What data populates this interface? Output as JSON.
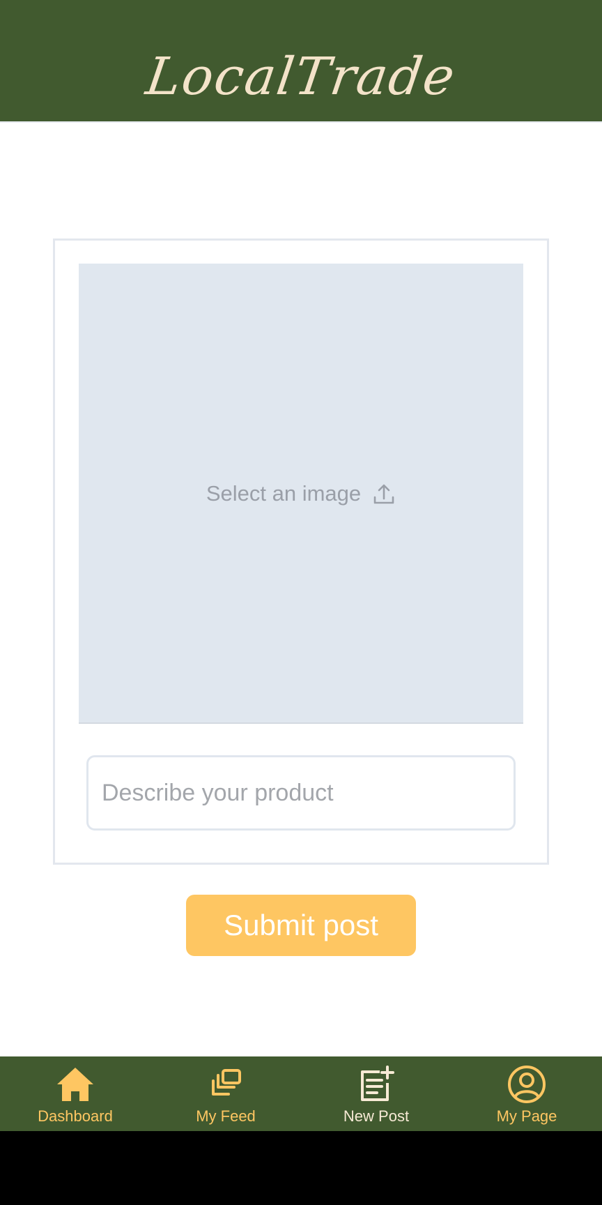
{
  "app": {
    "logo": "LocalTrade"
  },
  "form": {
    "image_prompt": "Select an image",
    "description_placeholder": "Describe your product",
    "description_value": "",
    "submit_label": "Submit post"
  },
  "nav": {
    "items": [
      {
        "label": "Dashboard",
        "icon": "home-icon",
        "active": false
      },
      {
        "label": "My Feed",
        "icon": "stacked-images-icon",
        "active": false
      },
      {
        "label": "New Post",
        "icon": "new-post-icon",
        "active": true
      },
      {
        "label": "My Page",
        "icon": "user-circle-icon",
        "active": false
      }
    ]
  },
  "colors": {
    "header_bg": "#415a2f",
    "logo": "#f3e3c9",
    "accent": "#fec662",
    "nav_active": "#f7ead5",
    "image_area_bg": "#e0e7ef"
  }
}
